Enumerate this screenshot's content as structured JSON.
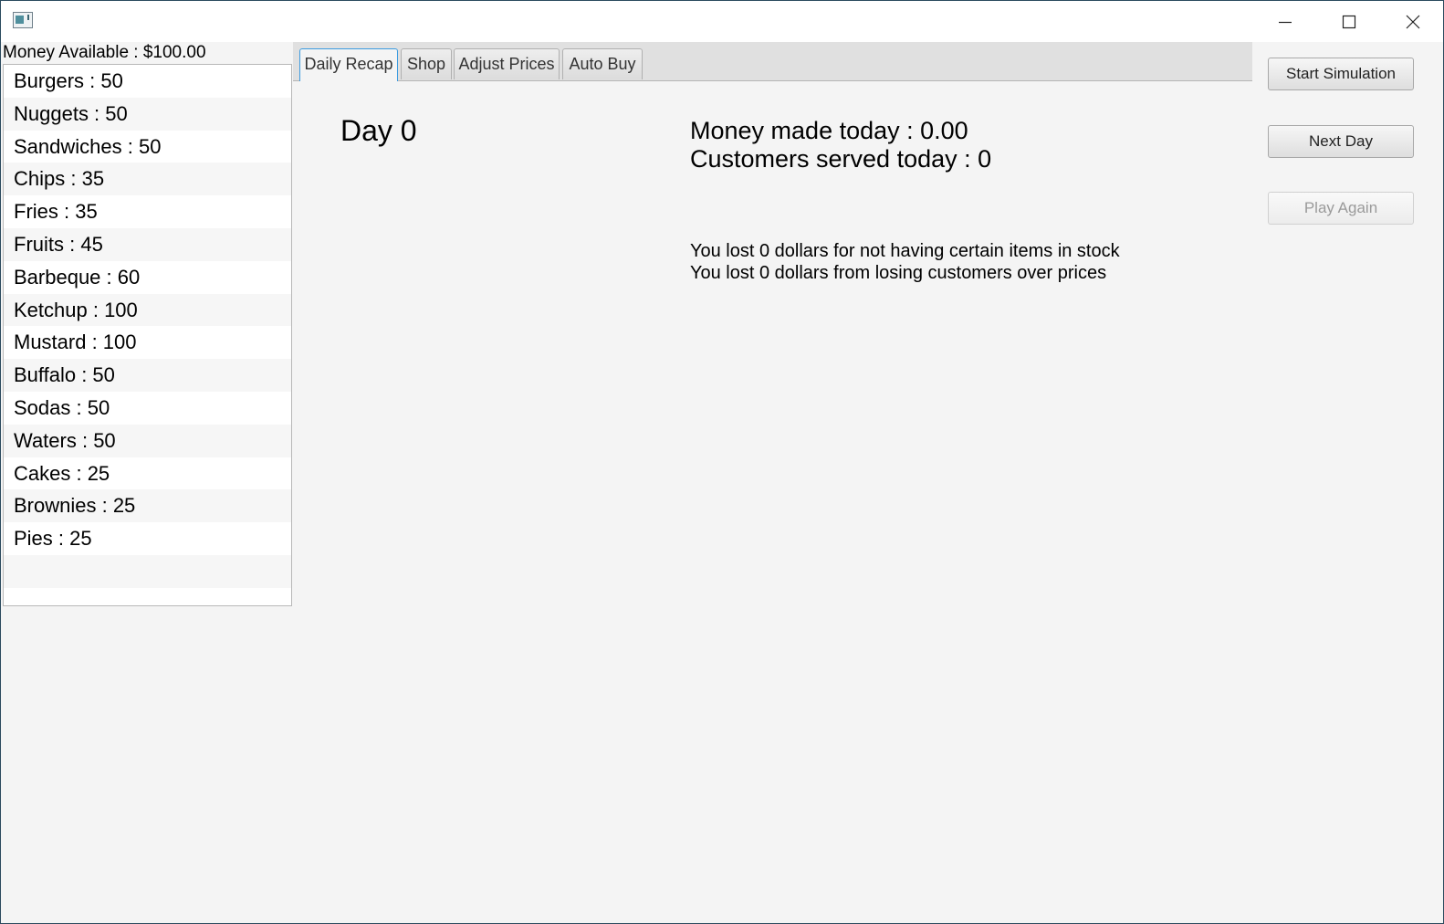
{
  "window": {
    "title": "",
    "icons": {
      "app": "app-icon",
      "minimize": "minimize-icon",
      "maximize": "maximize-icon",
      "close": "close-icon"
    }
  },
  "money_available": "Money Available : $100.00",
  "inventory": [
    {
      "label": "Burgers : 50"
    },
    {
      "label": "Nuggets : 50"
    },
    {
      "label": "Sandwiches : 50"
    },
    {
      "label": "Chips : 35"
    },
    {
      "label": "Fries : 35"
    },
    {
      "label": "Fruits : 45"
    },
    {
      "label": "Barbeque : 60"
    },
    {
      "label": "Ketchup : 100"
    },
    {
      "label": "Mustard : 100"
    },
    {
      "label": "Buffalo : 50"
    },
    {
      "label": "Sodas : 50"
    },
    {
      "label": "Waters : 50"
    },
    {
      "label": "Cakes : 25"
    },
    {
      "label": "Brownies : 25"
    },
    {
      "label": "Pies : 25"
    }
  ],
  "tabs": [
    {
      "label": "Daily Recap",
      "active": true
    },
    {
      "label": "Shop",
      "active": false
    },
    {
      "label": "Adjust Prices",
      "active": false
    },
    {
      "label": "Auto Buy",
      "active": false
    }
  ],
  "recap": {
    "day": "Day 0",
    "money_made": "Money made today : 0.00",
    "customers_served": "Customers served today : 0",
    "lost_stock": "You lost 0 dollars for not having certain items in stock",
    "lost_prices": "You lost 0 dollars from losing customers over prices"
  },
  "buttons": {
    "start_simulation": "Start Simulation",
    "next_day": "Next Day",
    "play_again": "Play Again",
    "play_again_enabled": false
  },
  "colors": {
    "active_tab_border": "#3c9be0",
    "window_border": "#2b4a5e",
    "background": "#f4f4f4"
  }
}
